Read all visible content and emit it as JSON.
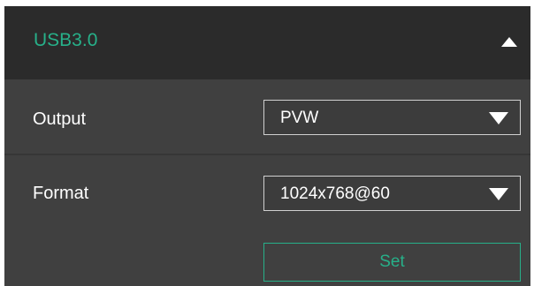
{
  "header": {
    "title": "USB3.0",
    "toggle_icon": "chevron-up-icon",
    "accent_color": "#27b089"
  },
  "settings": {
    "output": {
      "label": "Output",
      "value": "PVW",
      "dropdown_icon": "caret-down-icon"
    },
    "format": {
      "label": "Format",
      "value": "1024x768@60",
      "dropdown_icon": "caret-down-icon"
    }
  },
  "actions": {
    "set_label": "Set"
  }
}
